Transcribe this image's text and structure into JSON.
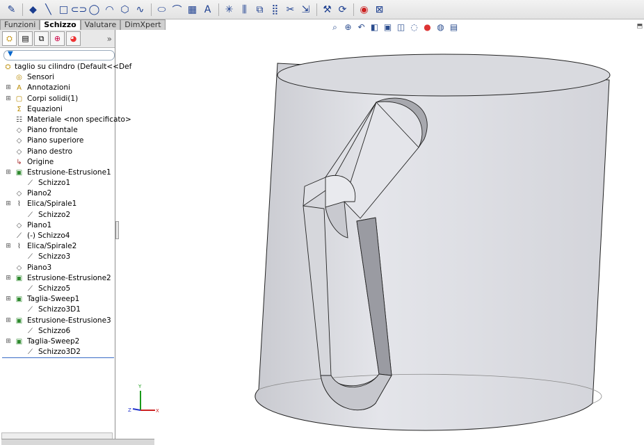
{
  "toolbar": {
    "icons": [
      "sketch-icon",
      "smart-dimension-icon",
      "line-icon",
      "rectangle-icon",
      "slot-icon",
      "circle-icon",
      "arc-icon",
      "polygon-icon",
      "spline-icon",
      "ellipse-icon",
      "fillet-icon",
      "point-icon",
      "text-icon",
      "centerline-icon",
      "mirror-icon",
      "offset-icon",
      "pattern-icon",
      "trim-icon",
      "move-icon",
      "repair-icon",
      "quick-snaps-icon",
      "rapid-sketch-icon",
      "instant2d-icon"
    ]
  },
  "tabs": [
    {
      "label": "Funzioni",
      "active": false
    },
    {
      "label": "Schizzo",
      "active": true
    },
    {
      "label": "Valutare",
      "active": false
    },
    {
      "label": "DimXpert",
      "active": false
    }
  ],
  "tree": {
    "root": "taglio su cilindro  (Default<<Def",
    "items": [
      {
        "label": "Sensori",
        "icon": "sensor-icon",
        "indent": 1,
        "expand": false
      },
      {
        "label": "Annotazioni",
        "icon": "annotation-icon",
        "indent": 1,
        "expand": true
      },
      {
        "label": "Corpi solidi(1)",
        "icon": "solid-bodies-icon",
        "indent": 1,
        "expand": true
      },
      {
        "label": "Equazioni",
        "icon": "equation-icon",
        "indent": 1,
        "expand": false
      },
      {
        "label": "Materiale <non specificato>",
        "icon": "material-icon",
        "indent": 1,
        "expand": false
      },
      {
        "label": "Piano frontale",
        "icon": "plane-icon",
        "indent": 1,
        "expand": false
      },
      {
        "label": "Piano superiore",
        "icon": "plane-icon",
        "indent": 1,
        "expand": false
      },
      {
        "label": "Piano destro",
        "icon": "plane-icon",
        "indent": 1,
        "expand": false
      },
      {
        "label": "Origine",
        "icon": "origin-icon",
        "indent": 1,
        "expand": false
      },
      {
        "label": "Estrusione-Estrusione1",
        "icon": "extrude-icon",
        "indent": 1,
        "expand": true
      },
      {
        "label": "Schizzo1",
        "icon": "sketch-icon",
        "indent": 2,
        "expand": false
      },
      {
        "label": "Piano2",
        "icon": "plane-icon",
        "indent": 1,
        "expand": false
      },
      {
        "label": "Elica/Spirale1",
        "icon": "helix-icon",
        "indent": 1,
        "expand": true
      },
      {
        "label": "Schizzo2",
        "icon": "sketch-icon",
        "indent": 2,
        "expand": false
      },
      {
        "label": "Piano1",
        "icon": "plane-icon",
        "indent": 1,
        "expand": false
      },
      {
        "label": "(-) Schizzo4",
        "icon": "sketch-icon",
        "indent": 1,
        "expand": false
      },
      {
        "label": "Elica/Spirale2",
        "icon": "helix-icon",
        "indent": 1,
        "expand": true
      },
      {
        "label": "Schizzo3",
        "icon": "sketch-icon",
        "indent": 2,
        "expand": false
      },
      {
        "label": "Piano3",
        "icon": "plane-icon",
        "indent": 1,
        "expand": false
      },
      {
        "label": "Estrusione-Estrusione2",
        "icon": "extrude-icon",
        "indent": 1,
        "expand": true
      },
      {
        "label": "Schizzo5",
        "icon": "sketch-icon",
        "indent": 2,
        "expand": false
      },
      {
        "label": "Taglia-Sweep1",
        "icon": "cut-sweep-icon",
        "indent": 1,
        "expand": true
      },
      {
        "label": "Schizzo3D1",
        "icon": "sketch3d-icon",
        "indent": 2,
        "expand": false
      },
      {
        "label": "Estrusione-Estrusione3",
        "icon": "extrude-icon",
        "indent": 1,
        "expand": true
      },
      {
        "label": "Schizzo6",
        "icon": "sketch-icon",
        "indent": 2,
        "expand": false
      },
      {
        "label": "Taglia-Sweep2",
        "icon": "cut-sweep-icon",
        "indent": 1,
        "expand": true
      },
      {
        "label": "Schizzo3D2",
        "icon": "sketch3d-icon",
        "indent": 2,
        "expand": false
      }
    ]
  },
  "triad": {
    "x": "X",
    "y": "Y",
    "z": "Z"
  },
  "colors": {
    "body": "#dcdde2",
    "accent": "#3a6cc6"
  }
}
